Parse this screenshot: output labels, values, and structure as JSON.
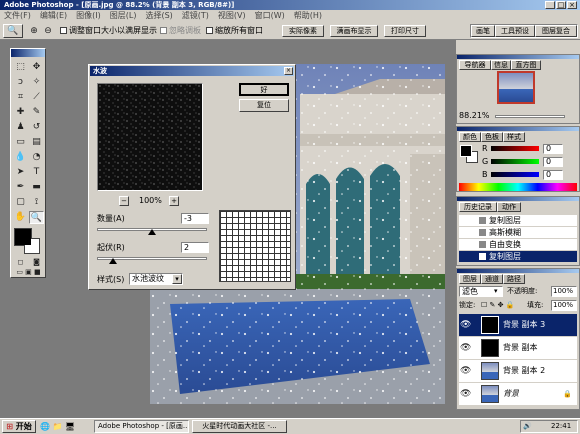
{
  "app": {
    "title": "Adobe Photoshop - [原画.jpg @ 88.2% (背景 副本 3, RGB/8#)]"
  },
  "menu": [
    "文件(F)",
    "编辑(E)",
    "图像(I)",
    "图层(L)",
    "选择(S)",
    "滤镜(T)",
    "视图(V)",
    "窗口(W)",
    "帮助(H)"
  ],
  "options": {
    "check1": "调整窗口大小以满屏显示",
    "check2": "忽略调板",
    "check3": "缩放所有窗口",
    "btn_actual": "实际像素",
    "btn_fit": "满画布显示",
    "btn_print": "打印尺寸"
  },
  "palette_well": [
    "画笔",
    "工具预设",
    "图层复合"
  ],
  "dialog": {
    "title": "水波",
    "ok": "好",
    "reset": "复位",
    "zoom": "100%",
    "amount_label": "数量(A)",
    "amount_value": "-3",
    "ridges_label": "起伏(R)",
    "ridges_value": "2",
    "style_label": "样式(S)",
    "style_value": "水池波纹",
    "minus": "−",
    "plus": "+"
  },
  "navigator": {
    "tabs": [
      "导航器",
      "信息",
      "直方图"
    ],
    "zoom": "88.21%"
  },
  "color": {
    "tabs": [
      "颜色",
      "色板",
      "样式"
    ],
    "r": "R",
    "g": "G",
    "b": "B",
    "r_val": "0",
    "g_val": "0",
    "b_val": "0"
  },
  "history": {
    "tabs": [
      "历史记录",
      "动作"
    ],
    "items": [
      "复制图层",
      "高斯模糊",
      "自由变换",
      "复制图层"
    ]
  },
  "layers": {
    "tabs": [
      "图层",
      "通道",
      "路径"
    ],
    "blend": "滤色",
    "opacity_label": "不透明度:",
    "opacity": "100%",
    "lock_label": "锁定:",
    "fill_label": "填充:",
    "fill": "100%",
    "items": [
      "背景 副本 3",
      "背景 副本",
      "背景 副本 2",
      "背景"
    ]
  },
  "taskbar": {
    "start": "开始",
    "task1": "Adobe Photoshop - [原画...",
    "task2": "火星时代动画大社区 -...",
    "time": "22:41"
  },
  "colors": {
    "titlebar_start": "#0a246a",
    "titlebar_end": "#a6caf0",
    "chrome": "#d4d0c8",
    "selected": "#0a246a"
  }
}
